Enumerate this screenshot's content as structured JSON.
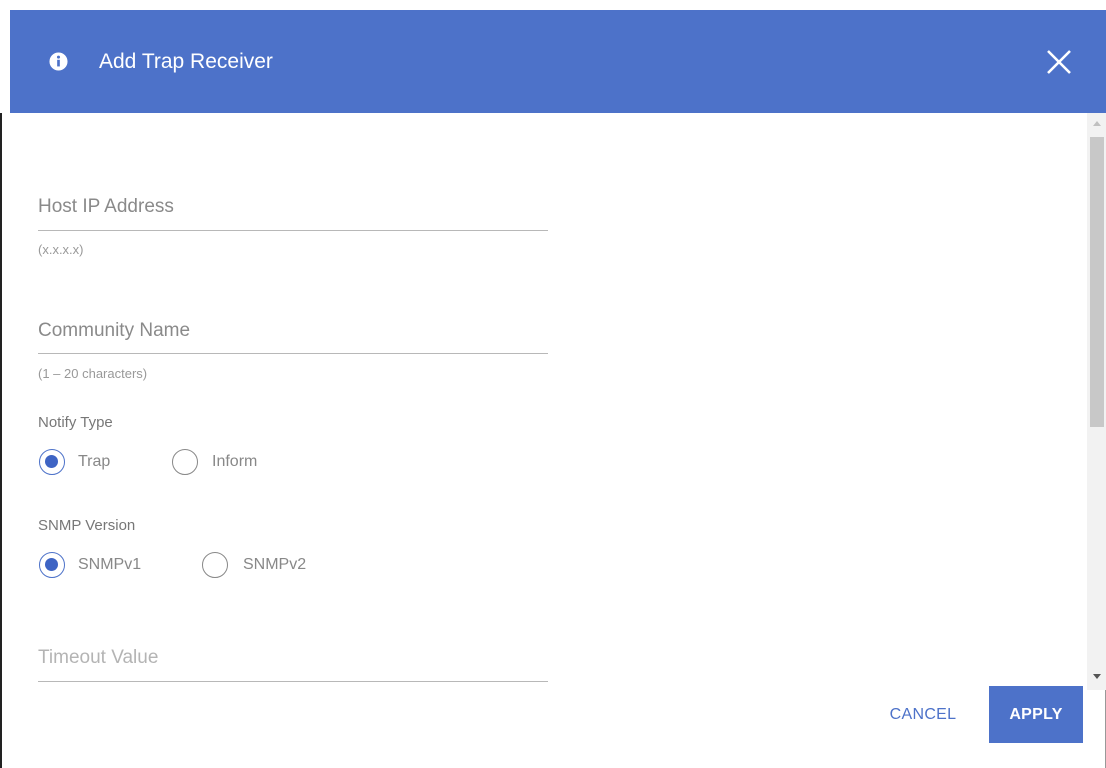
{
  "dialog": {
    "title": "Add Trap Receiver",
    "header_color": "#4d72c9",
    "icons": {
      "info": "info-circle-icon",
      "close": "close-x-icon"
    }
  },
  "fields": {
    "host_ip": {
      "label": "Host IP Address",
      "hint": "(x.x.x.x)",
      "value": ""
    },
    "community": {
      "label": "Community Name",
      "hint": "(1 – 20 characters)",
      "value": ""
    },
    "timeout": {
      "label": "Timeout Value",
      "value": ""
    }
  },
  "notify_type": {
    "label": "Notify Type",
    "options": [
      {
        "label": "Trap",
        "checked": true
      },
      {
        "label": "Inform",
        "checked": false
      }
    ]
  },
  "snmp_version": {
    "label": "SNMP Version",
    "options": [
      {
        "label": "SNMPv1",
        "checked": true
      },
      {
        "label": "SNMPv2",
        "checked": false
      }
    ]
  },
  "buttons": {
    "cancel": "CANCEL",
    "apply": "APPLY"
  }
}
